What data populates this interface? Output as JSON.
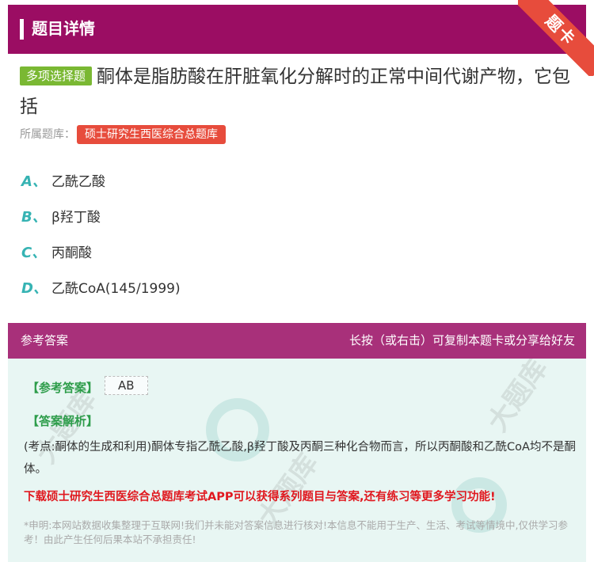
{
  "header": {
    "title": "题目详情",
    "ribbon": "题卡"
  },
  "question": {
    "type_badge": "多项选择题",
    "text": "酮体是脂肪酸在肝脏氧化分解时的正常中间代谢产物，它包括",
    "bank_label": "所属题库：",
    "bank_name": "硕士研究生西医综合总题库"
  },
  "options": [
    {
      "letter": "A、",
      "text": "乙酰乙酸"
    },
    {
      "letter": "B、",
      "text": "β羟丁酸"
    },
    {
      "letter": "C、",
      "text": "丙酮酸"
    },
    {
      "letter": "D、",
      "text": "乙酰CoA(145/1999)"
    }
  ],
  "answer_section": {
    "title": "参考答案",
    "share_hint": "长按（或右击）可复制本题卡或分享给好友",
    "ref_label": "【参考答案】",
    "ref_value": "AB",
    "analysis_label": "【答案解析】",
    "analysis_text": "(考点:酮体的生成和利用)酮体专指乙酰乙酸,β羟丁酸及丙酮三种化合物而言，所以丙酮酸和乙酰CoA均不是酮体。",
    "promo_text": "下载硕士研究生西医综合总题库考试APP可以获得系列题目与答案,还有练习等更多学习功能!",
    "disclaimer": "*申明:本网站数据收集整理于互联网!我们并未能对答案信息进行核对!本信息不能用于生产、生活、考试等情境中,仅供学习参考！由此产生任何后果本站不承担责任!"
  },
  "watermark": {
    "text": "大题库"
  },
  "colors": {
    "header_bg": "#9b0d63",
    "answer_header_bg": "#a8307a",
    "option_letter": "#36b3b3",
    "badge_green": "#7ab833",
    "bank_red": "#e74c3c",
    "answer_bg": "#e8f6f3"
  }
}
